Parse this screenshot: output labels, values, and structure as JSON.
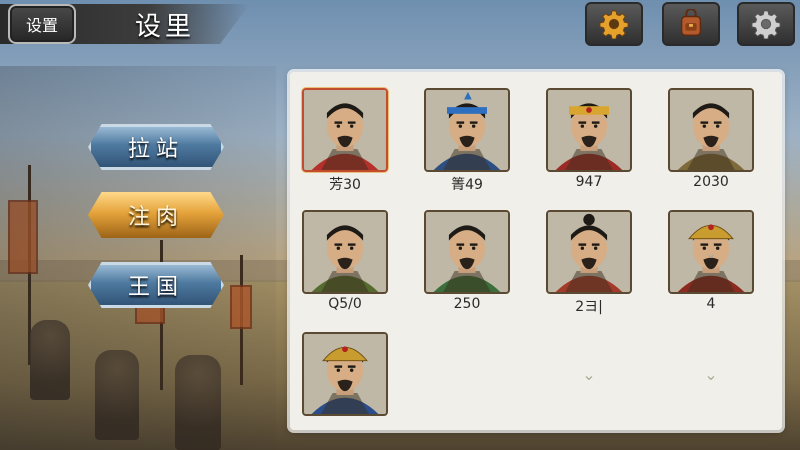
{
  "header": {
    "back_label": "设置",
    "title": "设里",
    "buttons": [
      {
        "icon": "gear-icon",
        "color": "#e6a12c"
      },
      {
        "icon": "backpack-icon",
        "color": "#b35b2c"
      },
      {
        "icon": "gear-icon",
        "color": "#c9c9c9"
      }
    ]
  },
  "menu": {
    "items": [
      {
        "label": "拉站",
        "style": "blue"
      },
      {
        "label": "注肉",
        "style": "gold",
        "selected": true
      },
      {
        "label": "王国",
        "style": "blue"
      }
    ]
  },
  "generals": [
    {
      "label": "芳30",
      "selected": true,
      "helmet": "none",
      "color": "#b5302a"
    },
    {
      "label": "箐49",
      "helmet": "band",
      "color": "#2d4f82"
    },
    {
      "label": "947",
      "helmet": "gold",
      "color": "#9c2b25"
    },
    {
      "label": "2030",
      "helmet": "none",
      "color": "#7f6a3a"
    },
    {
      "label": "Q5/0",
      "helmet": "none",
      "color": "#556b2f"
    },
    {
      "label": "250",
      "helmet": "none",
      "color": "#3b6e3a"
    },
    {
      "label": "2ヨ|",
      "helmet": "topknot",
      "color": "#a33a2a"
    },
    {
      "label": "",
      "helmet": "crown",
      "color": "#8c2a20"
    },
    {
      "label": "",
      "helmet": "crown",
      "color": "#2b4e8a"
    }
  ],
  "empty_slots": [
    {
      "label": "4"
    },
    {
      "label": ""
    },
    {
      "label": ""
    }
  ],
  "colors": {
    "accent_gold": "#e5a33b",
    "accent_blue": "#4f7aa0",
    "panel_bg": "#f1efe9"
  }
}
